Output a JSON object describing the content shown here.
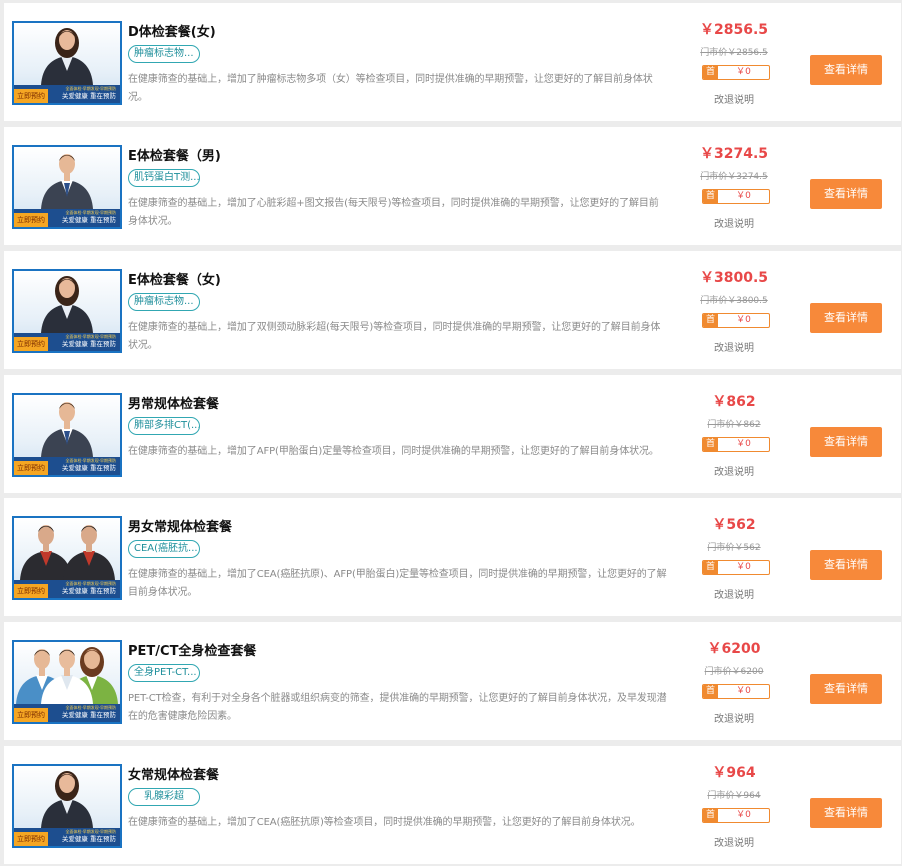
{
  "thumbnail": {
    "book_label": "立即预约",
    "slogan": "关爱健康 重在预防",
    "fine_print": "全面体检·早期发现·早期预防"
  },
  "colors": {
    "price": "#e84848",
    "button": "#f7893a",
    "tag_border": "#31a7b2",
    "thumb_border": "#1a73c2"
  },
  "packages": [
    {
      "title": "D体检套餐(女)",
      "tag": "肿瘤标志物...",
      "desc": "在健康筛查的基础上，增加了肿瘤标志物多项（女）等检查项目，同时提供准确的早期预警，让您更好的了解目前身体状况。",
      "price": "￥2856.5",
      "original_price": "门市价￥2856.5",
      "coupon_label": "首",
      "coupon_value": "￥0",
      "refund": "改退说明",
      "button": "查看详情",
      "figure": "woman",
      "tag_centered": false
    },
    {
      "title": "E体检套餐（男)",
      "tag": "肌钙蛋白T测...",
      "desc": "在健康筛查的基础上，增加了心脏彩超+图文报告(每天限号)等检查项目，同时提供准确的早期预警，让您更好的了解目前身体状况。",
      "price": "￥3274.5",
      "original_price": "门市价￥3274.5",
      "coupon_label": "首",
      "coupon_value": "￥0",
      "refund": "改退说明",
      "button": "查看详情",
      "figure": "man",
      "tag_centered": false
    },
    {
      "title": "E体检套餐（女)",
      "tag": "肿瘤标志物...",
      "desc": "在健康筛查的基础上，增加了双侧颈动脉彩超(每天限号)等检查项目，同时提供准确的早期预警，让您更好的了解目前身体状况。",
      "price": "￥3800.5",
      "original_price": "门市价￥3800.5",
      "coupon_label": "首",
      "coupon_value": "￥0",
      "refund": "改退说明",
      "button": "查看详情",
      "figure": "woman",
      "tag_centered": false
    },
    {
      "title": "男常规体检套餐",
      "tag": "肺部多排CT(...",
      "desc": "在健康筛查的基础上，增加了AFP(甲胎蛋白)定量等检查项目，同时提供准确的早期预警，让您更好的了解目前身体状况。",
      "price": "￥862",
      "original_price": "门市价￥862",
      "coupon_label": "首",
      "coupon_value": "￥0",
      "refund": "改退说明",
      "button": "查看详情",
      "figure": "man",
      "tag_centered": false
    },
    {
      "title": "男女常规体检套餐",
      "tag": "CEA(癌胚抗...",
      "desc": "在健康筛查的基础上，增加了CEA(癌胚抗原)、AFP(甲胎蛋白)定量等检查项目，同时提供准确的早期预警，让您更好的了解目前身体状况。",
      "price": "￥562",
      "original_price": "门市价￥562",
      "coupon_label": "首",
      "coupon_value": "￥0",
      "refund": "改退说明",
      "button": "查看详情",
      "figure": "couple",
      "tag_centered": false
    },
    {
      "title": "PET/CT全身检查套餐",
      "tag": "全身PET-CT...",
      "desc": "PET-CT检查，有利于对全身各个脏器或组织病变的筛查，提供准确的早期预警，让您更好的了解目前身体状况，及早发现潜在的危害健康危险因素。",
      "price": "￥6200",
      "original_price": "门市价￥6200",
      "coupon_label": "首",
      "coupon_value": "￥0",
      "refund": "改退说明",
      "button": "查看详情",
      "figure": "group",
      "tag_centered": false
    },
    {
      "title": "女常规体检套餐",
      "tag": "乳腺彩超",
      "desc": "在健康筛查的基础上，增加了CEA(癌胚抗原)等检查项目，同时提供准确的早期预警，让您更好的了解目前身体状况。",
      "price": "￥964",
      "original_price": "门市价￥964",
      "coupon_label": "首",
      "coupon_value": "￥0",
      "refund": "改退说明",
      "button": "查看详情",
      "figure": "woman",
      "tag_centered": true
    }
  ]
}
